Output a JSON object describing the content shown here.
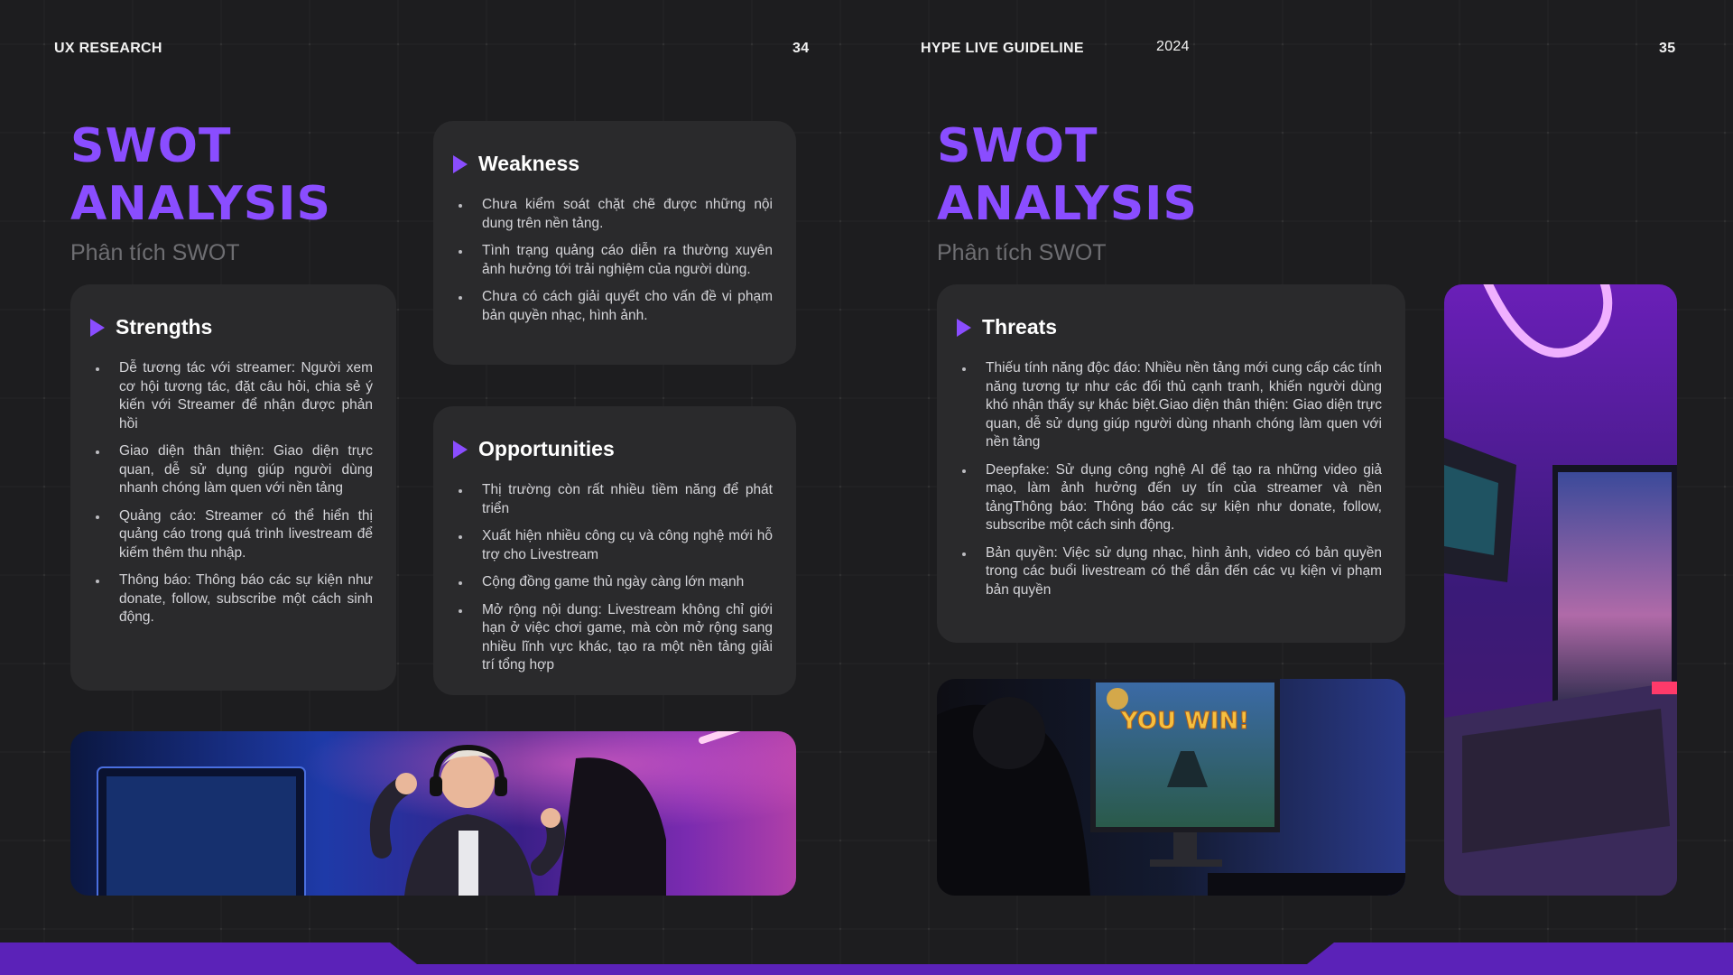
{
  "header": {
    "left_label": "UX RESEARCH",
    "left_page": "34",
    "right_label": "HYPE LIVE GUIDELINE",
    "year": "2024",
    "right_page": "35"
  },
  "left": {
    "title_line1": "SWOT",
    "title_line2": "ANALYSIS",
    "subtitle": "Phân tích SWOT",
    "strengths": {
      "title": "Strengths",
      "items": [
        "Dễ tương tác với streamer: Người xem cơ hội tương tác, đặt câu hỏi, chia sẻ ý kiến với Streamer để nhận được phản hồi",
        "Giao diện thân thiện: Giao diện trực quan, dễ sử dụng giúp người dùng nhanh chóng làm quen với nền tảng",
        "Quảng cáo: Streamer có thể hiển thị quảng cáo trong quá trình livestream để kiếm thêm thu nhập.",
        "Thông báo: Thông báo các sự kiện như donate, follow, subscribe một cách sinh động."
      ]
    },
    "weakness": {
      "title": "Weakness",
      "items": [
        "Chưa kiểm soát chặt chẽ được những nội dung trên nền tảng.",
        "Tình trạng quảng cáo diễn ra thường xuyên ảnh hưởng tới trải nghiệm của người dùng.",
        "Chưa có cách giải quyết cho vấn đề vi phạm bản quyền nhạc, hình ảnh."
      ]
    },
    "opportunities": {
      "title": "Opportunities",
      "items": [
        "Thị trường còn rất nhiều tiềm năng để phát triển",
        "Xuất hiện nhiều công cụ và công nghệ mới hỗ trợ cho Livestream",
        "Cộng đồng game thủ ngày càng lớn mạnh",
        "Mở rộng nội dung: Livestream không chỉ giới hạn ở việc chơi game, mà còn mở rộng sang nhiều lĩnh vực khác, tạo ra một nền tảng giải trí tổng hợp"
      ]
    }
  },
  "right": {
    "title_line1": "SWOT",
    "title_line2": "ANALYSIS",
    "subtitle": "Phân tích SWOT",
    "threats": {
      "title": "Threats",
      "items": [
        "Thiếu tính năng độc đáo: Nhiều nền tảng mới cung cấp các tính năng tương tự như các đối thủ cạnh tranh, khiến người dùng khó nhận thấy sự khác biệt.Giao diện thân thiện: Giao diện trực quan, dễ sử dụng giúp người dùng nhanh chóng làm quen với nền tảng",
        "Deepfake: Sử dụng công nghệ AI để tạo ra những video giả mạo, làm ảnh hưởng đến uy tín của streamer và nền tảngThông báo: Thông báo các sự kiện như donate, follow, subscribe một cách sinh động.",
        "Bản quyền: Việc sử dụng nhạc, hình ảnh, video có bản quyền trong các buổi livestream có thể dẫn đến các vụ kiện vi phạm bản quyền"
      ]
    },
    "screen_text": "YOU WIN!"
  },
  "colors": {
    "accent": "#8a4dff",
    "card": "#2a2a2c",
    "background": "#1d1d1f",
    "footer": "#5b22b8"
  }
}
